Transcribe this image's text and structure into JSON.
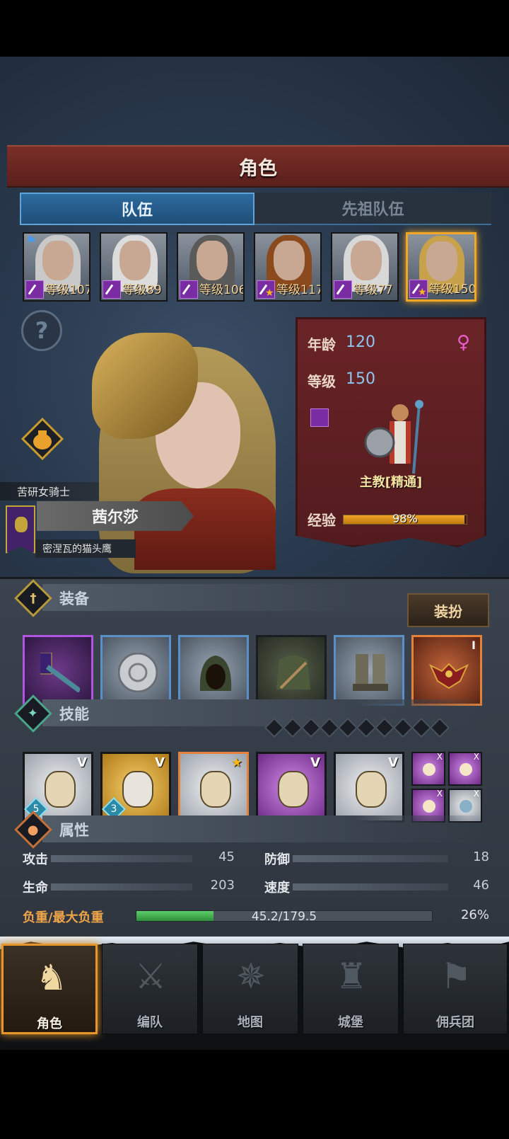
{
  "header": {
    "title": "角色"
  },
  "tabs": [
    {
      "label": "队伍",
      "active": true
    },
    {
      "label": "先祖队伍",
      "active": false
    }
  ],
  "party": [
    {
      "level_text": "等级107",
      "hair_color": "#c9c9c9",
      "flag": true,
      "star": false,
      "selected": false
    },
    {
      "level_text": "等级89",
      "hair_color": "#dcdcdc",
      "flag": false,
      "star": false,
      "selected": false
    },
    {
      "level_text": "等级106",
      "hair_color": "#5a5a5a",
      "flag": false,
      "star": false,
      "selected": false
    },
    {
      "level_text": "等级117",
      "hair_color": "#8a4a1e",
      "flag": false,
      "star": true,
      "selected": false
    },
    {
      "level_text": "等级77",
      "hair_color": "#d8d8d8",
      "flag": false,
      "star": false,
      "selected": false
    },
    {
      "level_text": "等级150",
      "hair_color": "#c8a24a",
      "flag": false,
      "star": true,
      "selected": true
    }
  ],
  "hero": {
    "title": "苦研女骑士",
    "name": "茜尔莎",
    "guild": "密涅瓦的猫头鹰"
  },
  "info": {
    "age_label": "年龄",
    "age_value": "120",
    "level_label": "等级",
    "level_value": "150",
    "gender_icon": "female-icon",
    "class_name": "主教[精通]",
    "exp_label": "经验",
    "exp_percent_text": "98%",
    "exp_fraction": 0.98
  },
  "equipment": {
    "section_label": "装备",
    "outfit_button": "装扮",
    "slots": [
      {
        "name": "staff",
        "rarity": "purple",
        "tier": ""
      },
      {
        "name": "shield",
        "rarity": "blue",
        "tier": ""
      },
      {
        "name": "hood",
        "rarity": "blue",
        "tier": ""
      },
      {
        "name": "tunic",
        "rarity": "plain",
        "tier": ""
      },
      {
        "name": "boots",
        "rarity": "blue",
        "tier": ""
      },
      {
        "name": "amulet",
        "rarity": "orange",
        "tier": "I"
      }
    ]
  },
  "skills": {
    "section_label": "技能",
    "pip_count": 10,
    "slots": [
      {
        "style": "white",
        "ver": "V",
        "count": "5",
        "border": "dark"
      },
      {
        "style": "gold",
        "ver": "V",
        "count": "3",
        "border": "dark"
      },
      {
        "style": "white",
        "ver": "★",
        "count": "",
        "border": "orange"
      },
      {
        "style": "purple",
        "ver": "V",
        "count": "",
        "border": "dark"
      },
      {
        "style": "white",
        "ver": "V",
        "count": "",
        "border": "dark"
      }
    ],
    "mini": [
      {
        "style": "purple",
        "mark": "X"
      },
      {
        "style": "purple",
        "mark": "X"
      },
      {
        "style": "purple",
        "mark": "X"
      },
      {
        "style": "white",
        "mark": "X"
      }
    ]
  },
  "attributes": {
    "section_label": "属性",
    "attack_label": "攻击",
    "attack_value": "45",
    "defense_label": "防御",
    "defense_value": "18",
    "hp_label": "生命",
    "hp_value": "203",
    "speed_label": "速度",
    "speed_value": "46",
    "weight_label": "负重/最大负重",
    "weight_text": "45.2/179.5",
    "weight_percent": "26%",
    "weight_fraction": 0.26
  },
  "nav": [
    {
      "label": "角色",
      "icon": "knight-icon",
      "active": true
    },
    {
      "label": "编队",
      "icon": "formation-icon",
      "active": false
    },
    {
      "label": "地图",
      "icon": "compass-map-icon",
      "active": false
    },
    {
      "label": "城堡",
      "icon": "castle-icon",
      "active": false
    },
    {
      "label": "佣兵团",
      "icon": "mercenary-icon",
      "active": false
    }
  ]
}
